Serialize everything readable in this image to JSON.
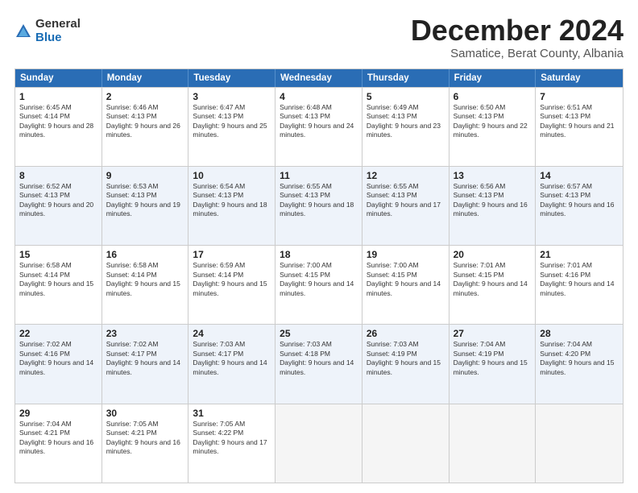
{
  "logo": {
    "general": "General",
    "blue": "Blue"
  },
  "title": "December 2024",
  "subtitle": "Samatice, Berat County, Albania",
  "days": [
    "Sunday",
    "Monday",
    "Tuesday",
    "Wednesday",
    "Thursday",
    "Friday",
    "Saturday"
  ],
  "weeks": [
    [
      {
        "day": "1",
        "info": "Sunrise: 6:45 AM\nSunset: 4:14 PM\nDaylight: 9 hours and 28 minutes."
      },
      {
        "day": "2",
        "info": "Sunrise: 6:46 AM\nSunset: 4:13 PM\nDaylight: 9 hours and 26 minutes."
      },
      {
        "day": "3",
        "info": "Sunrise: 6:47 AM\nSunset: 4:13 PM\nDaylight: 9 hours and 25 minutes."
      },
      {
        "day": "4",
        "info": "Sunrise: 6:48 AM\nSunset: 4:13 PM\nDaylight: 9 hours and 24 minutes."
      },
      {
        "day": "5",
        "info": "Sunrise: 6:49 AM\nSunset: 4:13 PM\nDaylight: 9 hours and 23 minutes."
      },
      {
        "day": "6",
        "info": "Sunrise: 6:50 AM\nSunset: 4:13 PM\nDaylight: 9 hours and 22 minutes."
      },
      {
        "day": "7",
        "info": "Sunrise: 6:51 AM\nSunset: 4:13 PM\nDaylight: 9 hours and 21 minutes."
      }
    ],
    [
      {
        "day": "8",
        "info": "Sunrise: 6:52 AM\nSunset: 4:13 PM\nDaylight: 9 hours and 20 minutes."
      },
      {
        "day": "9",
        "info": "Sunrise: 6:53 AM\nSunset: 4:13 PM\nDaylight: 9 hours and 19 minutes."
      },
      {
        "day": "10",
        "info": "Sunrise: 6:54 AM\nSunset: 4:13 PM\nDaylight: 9 hours and 18 minutes."
      },
      {
        "day": "11",
        "info": "Sunrise: 6:55 AM\nSunset: 4:13 PM\nDaylight: 9 hours and 18 minutes."
      },
      {
        "day": "12",
        "info": "Sunrise: 6:55 AM\nSunset: 4:13 PM\nDaylight: 9 hours and 17 minutes."
      },
      {
        "day": "13",
        "info": "Sunrise: 6:56 AM\nSunset: 4:13 PM\nDaylight: 9 hours and 16 minutes."
      },
      {
        "day": "14",
        "info": "Sunrise: 6:57 AM\nSunset: 4:13 PM\nDaylight: 9 hours and 16 minutes."
      }
    ],
    [
      {
        "day": "15",
        "info": "Sunrise: 6:58 AM\nSunset: 4:14 PM\nDaylight: 9 hours and 15 minutes."
      },
      {
        "day": "16",
        "info": "Sunrise: 6:58 AM\nSunset: 4:14 PM\nDaylight: 9 hours and 15 minutes."
      },
      {
        "day": "17",
        "info": "Sunrise: 6:59 AM\nSunset: 4:14 PM\nDaylight: 9 hours and 15 minutes."
      },
      {
        "day": "18",
        "info": "Sunrise: 7:00 AM\nSunset: 4:15 PM\nDaylight: 9 hours and 14 minutes."
      },
      {
        "day": "19",
        "info": "Sunrise: 7:00 AM\nSunset: 4:15 PM\nDaylight: 9 hours and 14 minutes."
      },
      {
        "day": "20",
        "info": "Sunrise: 7:01 AM\nSunset: 4:15 PM\nDaylight: 9 hours and 14 minutes."
      },
      {
        "day": "21",
        "info": "Sunrise: 7:01 AM\nSunset: 4:16 PM\nDaylight: 9 hours and 14 minutes."
      }
    ],
    [
      {
        "day": "22",
        "info": "Sunrise: 7:02 AM\nSunset: 4:16 PM\nDaylight: 9 hours and 14 minutes."
      },
      {
        "day": "23",
        "info": "Sunrise: 7:02 AM\nSunset: 4:17 PM\nDaylight: 9 hours and 14 minutes."
      },
      {
        "day": "24",
        "info": "Sunrise: 7:03 AM\nSunset: 4:17 PM\nDaylight: 9 hours and 14 minutes."
      },
      {
        "day": "25",
        "info": "Sunrise: 7:03 AM\nSunset: 4:18 PM\nDaylight: 9 hours and 14 minutes."
      },
      {
        "day": "26",
        "info": "Sunrise: 7:03 AM\nSunset: 4:19 PM\nDaylight: 9 hours and 15 minutes."
      },
      {
        "day": "27",
        "info": "Sunrise: 7:04 AM\nSunset: 4:19 PM\nDaylight: 9 hours and 15 minutes."
      },
      {
        "day": "28",
        "info": "Sunrise: 7:04 AM\nSunset: 4:20 PM\nDaylight: 9 hours and 15 minutes."
      }
    ],
    [
      {
        "day": "29",
        "info": "Sunrise: 7:04 AM\nSunset: 4:21 PM\nDaylight: 9 hours and 16 minutes."
      },
      {
        "day": "30",
        "info": "Sunrise: 7:05 AM\nSunset: 4:21 PM\nDaylight: 9 hours and 16 minutes."
      },
      {
        "day": "31",
        "info": "Sunrise: 7:05 AM\nSunset: 4:22 PM\nDaylight: 9 hours and 17 minutes."
      },
      {
        "day": "",
        "info": ""
      },
      {
        "day": "",
        "info": ""
      },
      {
        "day": "",
        "info": ""
      },
      {
        "day": "",
        "info": ""
      }
    ]
  ]
}
